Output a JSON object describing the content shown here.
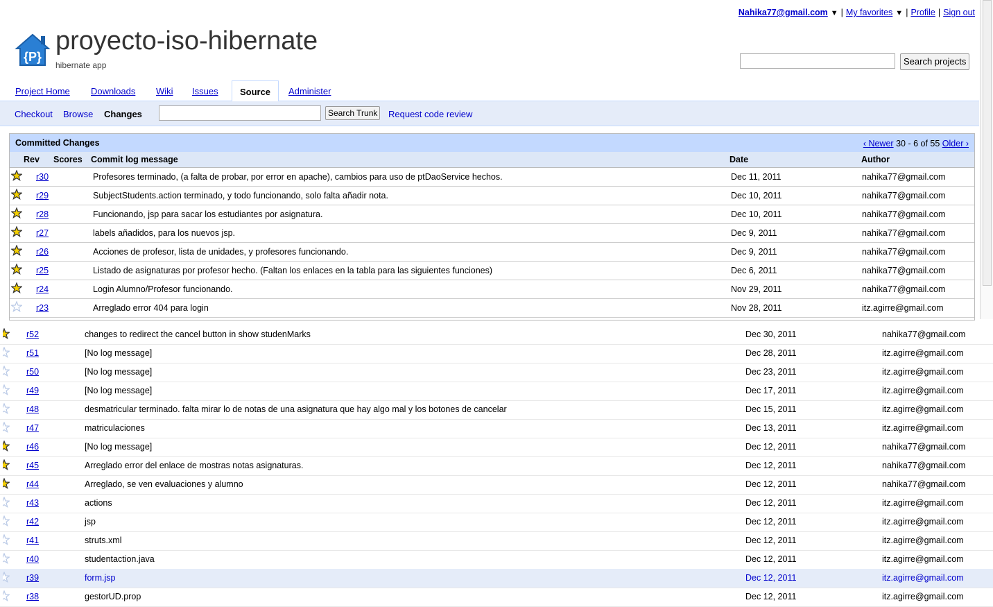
{
  "userbar": {
    "email": "Nahika77@gmail.com",
    "favorites": "My favorites",
    "profile": "Profile",
    "signout": "Sign out"
  },
  "header": {
    "logo_letter": "{P}",
    "title": "proyecto-iso-hibernate",
    "subtitle": "hibernate app",
    "search_button": "Search projects",
    "search_value": ""
  },
  "tabs": [
    "Project Home",
    "Downloads",
    "Wiki",
    "Issues",
    "Source",
    "Administer"
  ],
  "subnav": {
    "checkout": "Checkout",
    "browse": "Browse",
    "changes": "Changes",
    "search_trunk": "Search Trunk",
    "request_review": "Request code review"
  },
  "changes": {
    "title": "Committed Changes",
    "newer": "‹ Newer",
    "range": "30 - 6 of 55",
    "older": "Older ›",
    "columns": [
      "Rev",
      "Scores",
      "Commit log message",
      "Date",
      "Author"
    ],
    "rows": [
      {
        "rev": "r30",
        "msg": "Profesores terminado, (a falta de probar, por error en apache), cambios para uso de ptDaoService hechos.",
        "date": "Dec 11, 2011",
        "author": "nahika77@gmail.com",
        "starred": true
      },
      {
        "rev": "r29",
        "msg": "SubjectStudents.action terminado, y todo funcionando, solo falta añadir nota.",
        "date": "Dec 10, 2011",
        "author": "nahika77@gmail.com",
        "starred": true
      },
      {
        "rev": "r28",
        "msg": "Funcionando, jsp para sacar los estudiantes por asignatura.",
        "date": "Dec 10, 2011",
        "author": "nahika77@gmail.com",
        "starred": true
      },
      {
        "rev": "r27",
        "msg": "labels añadidos, para los nuevos jsp.",
        "date": "Dec 9, 2011",
        "author": "nahika77@gmail.com",
        "starred": true
      },
      {
        "rev": "r26",
        "msg": "Acciones de profesor, lista de unidades, y profesores funcionando.",
        "date": "Dec 9, 2011",
        "author": "nahika77@gmail.com",
        "starred": true
      },
      {
        "rev": "r25",
        "msg": "Listado de asignaturas por profesor hecho. (Faltan los enlaces en la tabla para las siguientes funciones)",
        "date": "Dec 6, 2011",
        "author": "nahika77@gmail.com",
        "starred": true
      },
      {
        "rev": "r24",
        "msg": "Login Alumno/Profesor funcionando.",
        "date": "Nov 29, 2011",
        "author": "nahika77@gmail.com",
        "starred": true
      },
      {
        "rev": "r23",
        "msg": "Arreglado error 404 para login",
        "date": "Nov 28, 2011",
        "author": "itz.agirre@gmail.com",
        "starred": false
      }
    ]
  },
  "lower_rows": [
    {
      "rev": "r52",
      "msg": "changes to redirect the cancel button in show studenMarks",
      "date": "Dec 30, 2011",
      "author": "nahika77@gmail.com",
      "starred": true
    },
    {
      "rev": "r51",
      "msg": "[No log message]",
      "date": "Dec 28, 2011",
      "author": "itz.agirre@gmail.com",
      "starred": false
    },
    {
      "rev": "r50",
      "msg": "[No log message]",
      "date": "Dec 23, 2011",
      "author": "itz.agirre@gmail.com",
      "starred": false
    },
    {
      "rev": "r49",
      "msg": "[No log message]",
      "date": "Dec 17, 2011",
      "author": "itz.agirre@gmail.com",
      "starred": false
    },
    {
      "rev": "r48",
      "msg": "desmatricular terminado. falta mirar lo de notas de una asignatura que hay algo mal y los botones de cancelar",
      "date": "Dec 15, 2011",
      "author": "itz.agirre@gmail.com",
      "starred": false
    },
    {
      "rev": "r47",
      "msg": "matriculaciones",
      "date": "Dec 13, 2011",
      "author": "itz.agirre@gmail.com",
      "starred": false
    },
    {
      "rev": "r46",
      "msg": "[No log message]",
      "date": "Dec 12, 2011",
      "author": "nahika77@gmail.com",
      "starred": true
    },
    {
      "rev": "r45",
      "msg": "Arreglado error del enlace de mostras notas asignaturas.",
      "date": "Dec 12, 2011",
      "author": "nahika77@gmail.com",
      "starred": true
    },
    {
      "rev": "r44",
      "msg": "Arreglado, se ven evaluaciones y alumno",
      "date": "Dec 12, 2011",
      "author": "nahika77@gmail.com",
      "starred": true
    },
    {
      "rev": "r43",
      "msg": "actions",
      "date": "Dec 12, 2011",
      "author": "itz.agirre@gmail.com",
      "starred": false
    },
    {
      "rev": "r42",
      "msg": "jsp",
      "date": "Dec 12, 2011",
      "author": "itz.agirre@gmail.com",
      "starred": false
    },
    {
      "rev": "r41",
      "msg": "struts.xml",
      "date": "Dec 12, 2011",
      "author": "itz.agirre@gmail.com",
      "starred": false
    },
    {
      "rev": "r40",
      "msg": "studentaction.java",
      "date": "Dec 12, 2011",
      "author": "itz.agirre@gmail.com",
      "starred": false
    },
    {
      "rev": "r39",
      "msg": "form.jsp",
      "date": "Dec 12, 2011",
      "author": "itz.agirre@gmail.com",
      "starred": false,
      "highlight": true
    },
    {
      "rev": "r38",
      "msg": "gestorUD.prop",
      "date": "Dec 12, 2011",
      "author": "itz.agirre@gmail.com",
      "starred": false
    }
  ],
  "colors": {
    "tab_border": "#c3d9ff",
    "subbar_bg": "#e5ecf9",
    "link": "#0000cc",
    "star_fill": "#f5d000"
  }
}
